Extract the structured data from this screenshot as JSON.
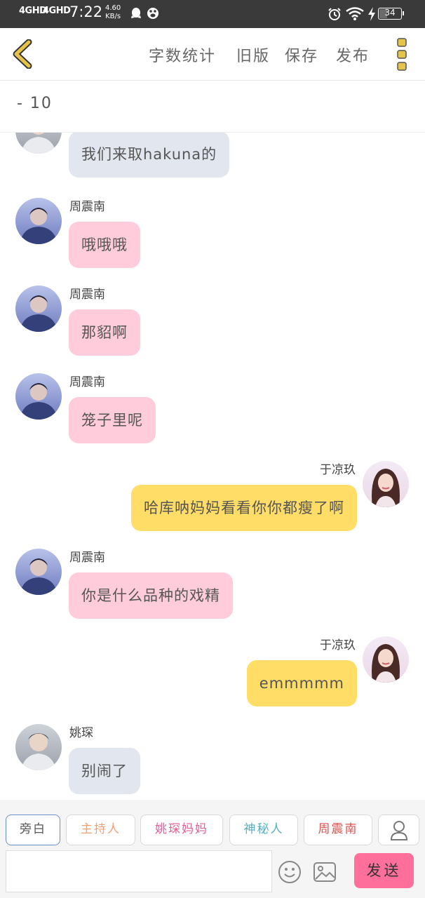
{
  "status_bar": {
    "network_1": "4GHD",
    "network_2": "4GHD",
    "time": "7:22",
    "speed_value": "4.60",
    "speed_unit": "KB/s",
    "battery": "34",
    "icons": [
      "qq-icon",
      "baidu-paw-icon",
      "alarm-icon",
      "wifi-icon",
      "charging-icon",
      "battery-icon"
    ]
  },
  "toolbar": {
    "word_count": "字数统计",
    "old_version": "旧版",
    "save": "保存",
    "publish": "发布",
    "accent_color": "#e6c34a"
  },
  "title": "- 10",
  "messages": [
    {
      "side": "left",
      "name": "",
      "text": "我们来取hakuna的",
      "color": "grey",
      "avatar": "male-avatar-2"
    },
    {
      "side": "left",
      "name": "周震南",
      "text": "哦哦哦",
      "color": "pink",
      "avatar": "male-avatar-1"
    },
    {
      "side": "left",
      "name": "周震南",
      "text": "那貂啊",
      "color": "pink",
      "avatar": "male-avatar-1"
    },
    {
      "side": "left",
      "name": "周震南",
      "text": "笼子里呢",
      "color": "pink",
      "avatar": "male-avatar-1"
    },
    {
      "side": "right",
      "name": "于凉玖",
      "text": "哈库呐妈妈看看你你都瘦了啊",
      "color": "yellow",
      "avatar": "female-avatar"
    },
    {
      "side": "left",
      "name": "周震南",
      "text": "你是什么品种的戏精",
      "color": "pink",
      "avatar": "male-avatar-1"
    },
    {
      "side": "right",
      "name": "于凉玖",
      "text": "emmmmm",
      "color": "yellow",
      "avatar": "female-avatar"
    },
    {
      "side": "left",
      "name": "姚琛",
      "text": "别闹了",
      "color": "grey",
      "avatar": "male-avatar-2"
    }
  ],
  "bubble_colors": {
    "grey": "#e2e7ef",
    "pink": "#ffccdb",
    "yellow": "#ffdd66"
  },
  "roles": [
    {
      "label": "旁白",
      "color": "#555555",
      "active": true
    },
    {
      "label": "主持人",
      "color": "#f0a070"
    },
    {
      "label": "姚琛妈妈",
      "color": "#e0609a"
    },
    {
      "label": "神秘人",
      "color": "#5aaec0"
    },
    {
      "label": "周震南",
      "color": "#d9534f"
    }
  ],
  "input": {
    "value": "",
    "placeholder": ""
  },
  "send_label": "发送",
  "send_color": "#ff6f9c"
}
